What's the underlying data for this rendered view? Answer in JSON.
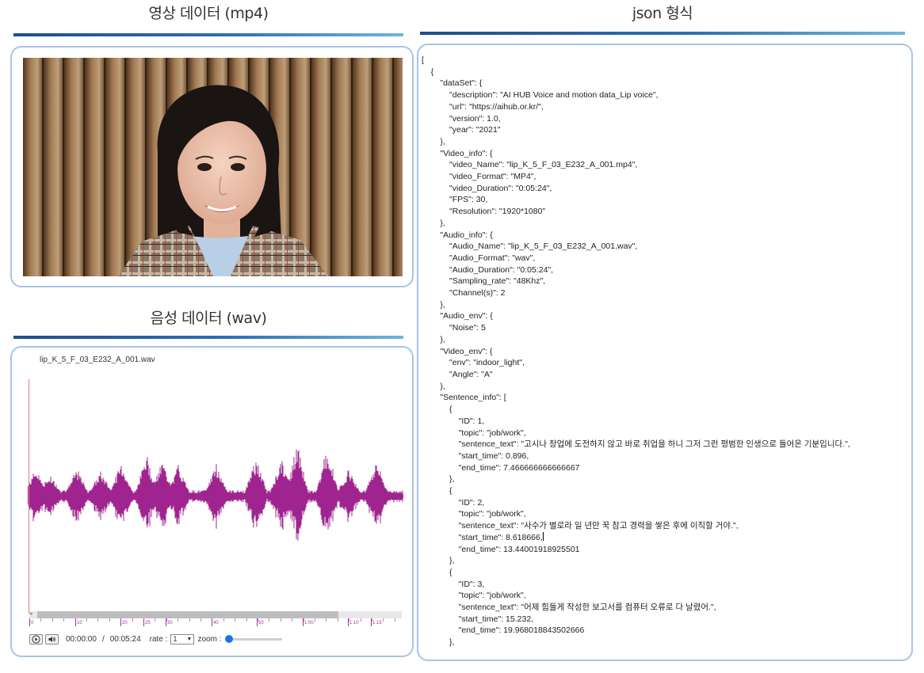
{
  "video_section": {
    "title": "영상 데이터 (mp4)"
  },
  "audio_section": {
    "title": "음성 데이터 (wav)",
    "file_name": "lip_K_5_F_03_E232_A_001.wav",
    "timeline_ticks": [
      "0",
      "10",
      "20",
      "25",
      "30",
      "40",
      "50",
      "1:00",
      "1:10",
      "1:15"
    ],
    "current_time": "00:00:00",
    "separator": "/",
    "total_time": "00:05:24",
    "rate_label": "rate :",
    "rate_value": "1",
    "zoom_label": "zoom :",
    "zoom_level": 0,
    "waveform_color": "#a0248f"
  },
  "json_section": {
    "title": "json 형식",
    "lines": [
      "[",
      "    {",
      "        \"dataSet\": {",
      "            \"description\": \"AI HUB Voice and motion data_Lip voice\",",
      "            \"url\": \"https://aihub.or.kr/\",",
      "            \"version\": 1.0,",
      "            \"year\": \"2021\"",
      "        },",
      "        \"Video_info\": {",
      "            \"video_Name\": \"lip_K_5_F_03_E232_A_001.mp4\",",
      "            \"video_Format\": \"MP4\",",
      "            \"video_Duration\": \"0:05:24\",",
      "            \"FPS\": 30,",
      "            \"Resolution\": \"1920*1080\"",
      "        },",
      "        \"Audio_info\": {",
      "            \"Audio_Name\": \"lip_K_5_F_03_E232_A_001.wav\",",
      "            \"Audio_Format\": \"wav\",",
      "            \"Audio_Duration\": \"0:05:24\",",
      "            \"Sampling_rate\": \"48Khz\",",
      "            \"Channel(s)\": 2",
      "        },",
      "        \"Audio_env\": {",
      "            \"Noise\": 5",
      "        },",
      "        \"Video_env\": {",
      "            \"env\": \"indoor_light\",",
      "            \"Angle\": \"A\"",
      "        },",
      "        \"Sentence_info\": [",
      "            {",
      "                \"ID\": 1,",
      "                \"topic\": \"job/work\",",
      "                \"sentence_text\": \"고시나 창업에 도전하지 않고 바로 취업을 하니 그저 그런 평범한 인생으로 들어온 기분입니다.\",",
      "                \"start_time\": 0.896,",
      "                \"end_time\": 7.466666666666667",
      "            },",
      "            {",
      "                \"ID\": 2,",
      "                \"topic\": \"job/work\",",
      "                \"sentence_text\": \"사수가 별로라 일 년만 꾹 참고 경력을 쌓은 후에 이직할 거야.\",",
      "                \"start_time\": 8.618666,",
      "                \"end_time\": 13.44001918925501",
      "            },",
      "            {",
      "                \"ID\": 3,",
      "                \"topic\": \"job/work\",",
      "                \"sentence_text\": \"어제 힘들게 작성한 보고서를 컴퓨터 오류로 다 날렸어.\",",
      "                \"start_time\": 15.232,",
      "                \"end_time\": 19.968018843502666",
      "            },"
    ]
  },
  "colors": {
    "panel_border": "#a9c4e6",
    "title_bar_start": "#1f4e8c",
    "title_bar_end": "#6fb6dc",
    "timeline": "#a0379a",
    "cursor": "#e47a82"
  }
}
